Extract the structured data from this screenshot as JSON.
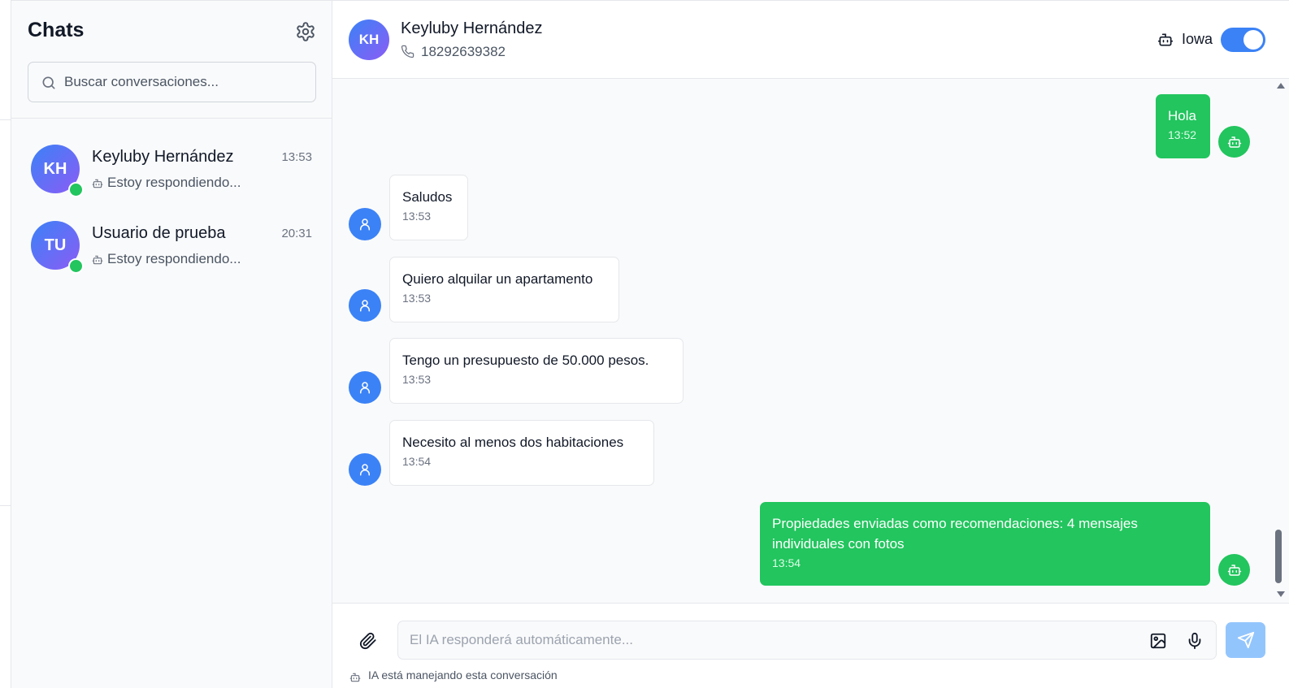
{
  "sidebar": {
    "title": "Chats",
    "search_placeholder": "Buscar conversaciones...",
    "conversations": [
      {
        "initials": "KH",
        "name": "Keyluby Hernández",
        "time": "13:53",
        "preview": "Estoy respondiendo...",
        "online": true
      },
      {
        "initials": "TU",
        "name": "Usuario de prueba",
        "time": "20:31",
        "preview": "Estoy respondiendo...",
        "online": true
      }
    ]
  },
  "chat": {
    "contact": {
      "initials": "KH",
      "name": "Keyluby Hernández",
      "phone": "18292639382"
    },
    "ai_label": "Iowa",
    "ai_enabled": true,
    "messages": [
      {
        "direction": "out",
        "sender": "bot",
        "text": "Hola",
        "time": "13:52"
      },
      {
        "direction": "in",
        "sender": "user",
        "text": "Saludos",
        "time": "13:53"
      },
      {
        "direction": "in",
        "sender": "user",
        "text": "Quiero alquilar un apartamento",
        "time": "13:53"
      },
      {
        "direction": "in",
        "sender": "user",
        "text": "Tengo un presupuesto de 50.000 pesos.",
        "time": "13:53"
      },
      {
        "direction": "in",
        "sender": "user",
        "text": "Necesito al menos dos habitaciones",
        "time": "13:54"
      },
      {
        "direction": "out",
        "sender": "bot",
        "text": "Propiedades enviadas como recomendaciones: 4 mensajes individuales con fotos",
        "time": "13:54"
      }
    ]
  },
  "composer": {
    "placeholder": "El IA responderá automáticamente...",
    "ai_note": "IA está manejando esta conversación"
  },
  "icons": {
    "settings": "gear-icon",
    "search": "search-icon",
    "phone": "phone-icon",
    "bot": "bot-icon",
    "user": "user-icon",
    "attach": "paperclip-icon",
    "image": "image-icon",
    "mic": "mic-icon",
    "send": "send-icon"
  },
  "colors": {
    "accent": "#3b82f6",
    "outgoing_bubble": "#22c55e",
    "online": "#22c55e",
    "avatar_gradient_start": "#3b82f6",
    "avatar_gradient_end": "#8b5cf6",
    "send_disabled": "#93c5fd"
  }
}
